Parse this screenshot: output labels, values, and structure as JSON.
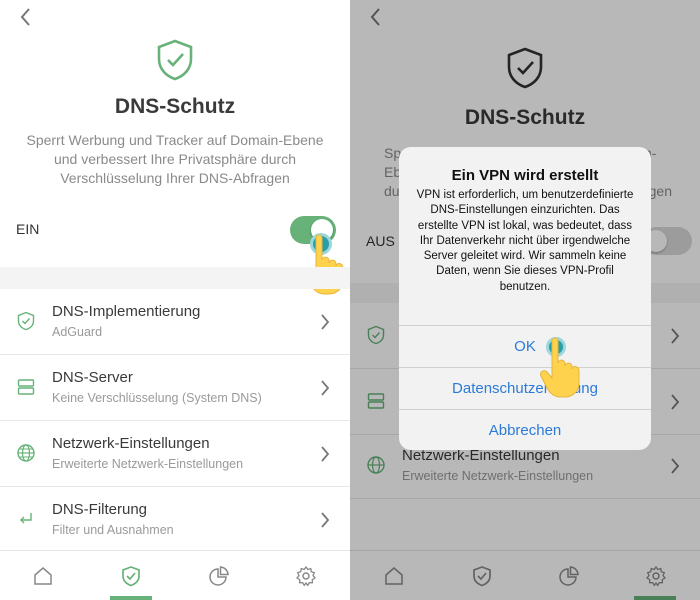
{
  "colors": {
    "accent": "#67b279",
    "link": "#2b7bd8",
    "toggle_on": "#67b279",
    "toggle_off": "#d9d9d9",
    "hand": "#ffd24d",
    "touch": "#2b9da6"
  },
  "left": {
    "back_icon": "chevron-left-icon",
    "title": "DNS-Schutz",
    "description": "Sperrt Werbung und Tracker auf Domain-Ebene und verbessert Ihre Privatsphäre durch Verschlüsselung Ihrer DNS-Abfragen",
    "toggle_label": "EIN",
    "toggle_on": true,
    "items": [
      {
        "icon": "shield-icon",
        "title": "DNS-Implementierung",
        "subtitle": "AdGuard"
      },
      {
        "icon": "server-icon",
        "title": "DNS-Server",
        "subtitle": "Keine Verschlüsselung (System DNS)"
      },
      {
        "icon": "globe-icon",
        "title": "Netzwerk-Einstellungen",
        "subtitle": "Erweiterte Netzwerk-Einstellungen"
      },
      {
        "icon": "filter-icon",
        "title": "DNS-Filterung",
        "subtitle": "Filter und Ausnahmen"
      }
    ],
    "tabs": [
      "home-icon",
      "shield-check-icon",
      "chart-icon",
      "gear-icon"
    ],
    "active_tab": 1
  },
  "right": {
    "title": "DNS-Schutz",
    "desc_left_fragments": [
      "Sp",
      "Eb",
      "du"
    ],
    "desc_right_fragments": [
      "in-",
      "e",
      "agen"
    ],
    "toggle_label": "AUS",
    "toggle_on": false,
    "partial_item": {
      "title": "Netzwerk-Einstellungen",
      "subtitle": "Erweiterte Netzwerk-Einstellungen"
    },
    "dialog": {
      "title": "Ein VPN wird erstellt",
      "body": "VPN ist erforderlich, um benutzerdefinierte DNS-Einstellungen einzurichten. Das erstellte VPN ist lokal, was bedeutet, dass Ihr Datenverkehr nicht über irgendwelche Server geleitet wird. Wir sammeln keine Daten, wenn Sie dieses VPN-Profil benutzen.",
      "ok": "OK",
      "privacy": "Datenschutzerklärung",
      "cancel": "Abbrechen"
    }
  }
}
